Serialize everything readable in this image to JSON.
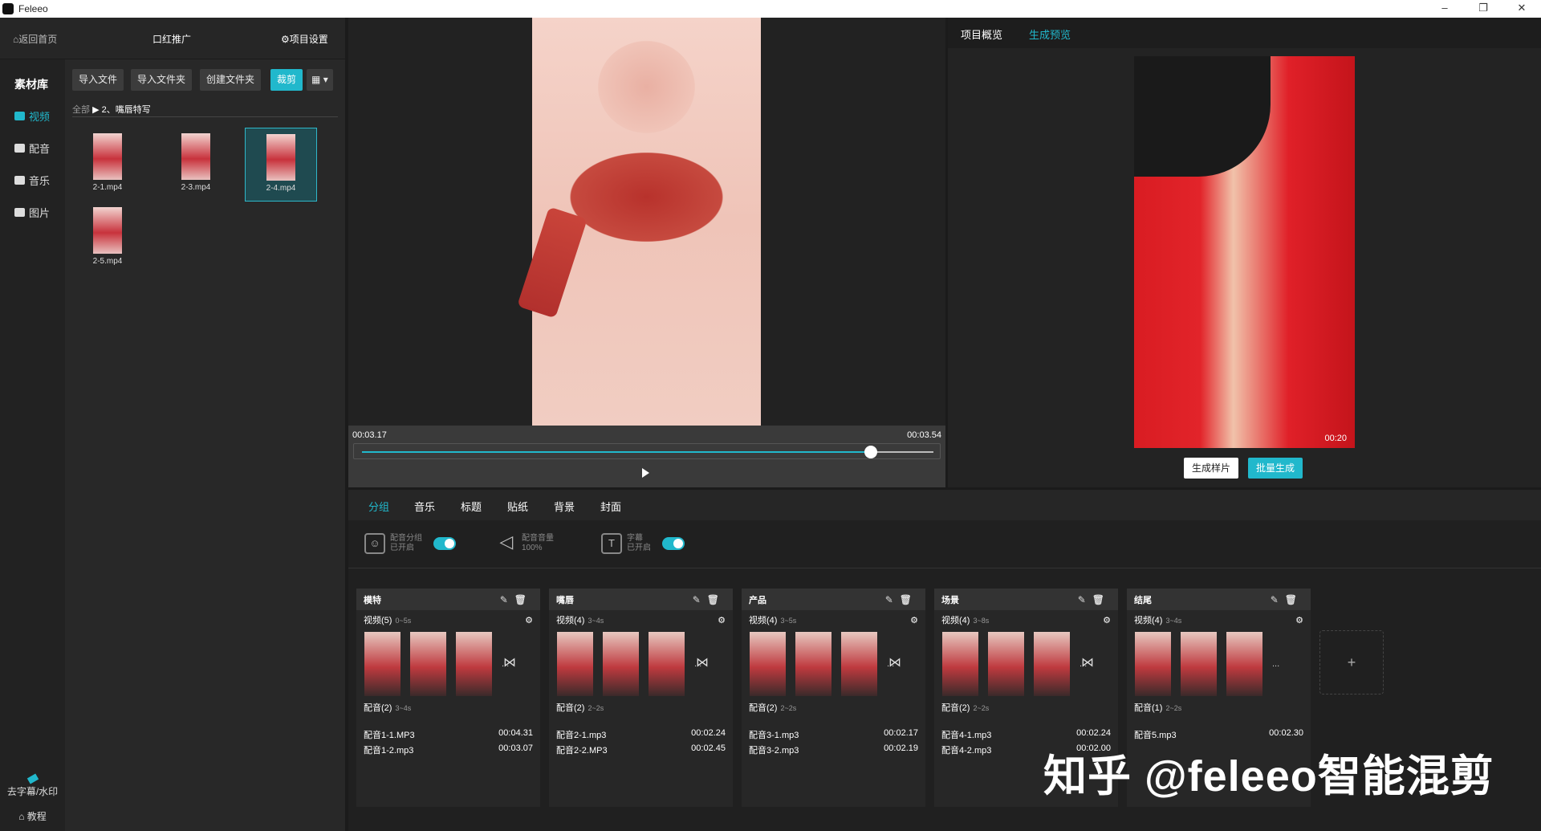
{
  "app": {
    "title": "Feleeo",
    "window_controls": [
      "–",
      "❐",
      "✕"
    ]
  },
  "header": {
    "back_label": "返回首页",
    "project_name": "口红推广",
    "settings_label": "项目设置"
  },
  "rail": {
    "heading": "素材库",
    "items": [
      {
        "label": "视频",
        "icon": "video-icon",
        "active": true
      },
      {
        "label": "配音",
        "icon": "voice-icon",
        "active": false
      },
      {
        "label": "音乐",
        "icon": "music-icon",
        "active": false
      },
      {
        "label": "图片",
        "icon": "image-icon",
        "active": false
      }
    ],
    "watermark_label": "去字幕/水印",
    "tutorial_label": "教程"
  },
  "library": {
    "buttons": [
      "导入文件",
      "导入文件夹",
      "创建文件夹",
      "裁剪"
    ],
    "active_button": "裁剪",
    "breadcrumb_root": "全部",
    "breadcrumb_path": "▶ 2、嘴唇特写",
    "assets": [
      "2-1.mp4",
      "2-3.mp4",
      "2-4.mp4",
      "2-5.mp4"
    ],
    "selected_asset": "2-4.mp4"
  },
  "preview": {
    "current_time": "00:03.17",
    "total_time": "00:03.54",
    "progress": 0.89
  },
  "generator": {
    "tabs": [
      "项目概览",
      "生成预览"
    ],
    "active_tab": "生成预览",
    "duration": "00:20",
    "sample_button": "生成样片",
    "batch_button": "批量生成",
    "accent": "#21b8cc"
  },
  "bottom": {
    "tabs": [
      "分组",
      "音乐",
      "标题",
      "贴纸",
      "背景",
      "封面"
    ],
    "active_tab": "分组",
    "options": [
      {
        "icon": "voice-group-icon",
        "title": "配音分组",
        "value": "已开启",
        "toggle": true
      },
      {
        "icon": "volume-icon",
        "title": "配音音量",
        "value": "100%",
        "toggle": false
      },
      {
        "icon": "subtitle-icon",
        "title": "字幕",
        "value": "已开启",
        "toggle": true
      }
    ],
    "groups": [
      {
        "name": "模特",
        "video_label": "视频(5)",
        "video_range": "0~5s",
        "voice_label": "配音(2)",
        "voice_range": "3~4s",
        "files": [
          {
            "name": "配音1-1.MP3",
            "dur": "00:04.31"
          },
          {
            "name": "配音1-2.mp3",
            "dur": "00:03.07"
          }
        ]
      },
      {
        "name": "嘴唇",
        "video_label": "视频(4)",
        "video_range": "3~4s",
        "voice_label": "配音(2)",
        "voice_range": "2~2s",
        "files": [
          {
            "name": "配音2-1.mp3",
            "dur": "00:02.24"
          },
          {
            "name": "配音2-2.MP3",
            "dur": "00:02.45"
          }
        ]
      },
      {
        "name": "产品",
        "video_label": "视频(4)",
        "video_range": "3~5s",
        "voice_label": "配音(2)",
        "voice_range": "2~2s",
        "files": [
          {
            "name": "配音3-1.mp3",
            "dur": "00:02.17"
          },
          {
            "name": "配音3-2.mp3",
            "dur": "00:02.19"
          }
        ]
      },
      {
        "name": "场景",
        "video_label": "视频(4)",
        "video_range": "3~8s",
        "voice_label": "配音(2)",
        "voice_range": "2~2s",
        "files": [
          {
            "name": "配音4-1.mp3",
            "dur": "00:02.24"
          },
          {
            "name": "配音4-2.mp3",
            "dur": "00:02.00"
          }
        ]
      },
      {
        "name": "结尾",
        "video_label": "视频(4)",
        "video_range": "3~4s",
        "voice_label": "配音(1)",
        "voice_range": "2~2s",
        "files": [
          {
            "name": "配音5.mp3",
            "dur": "00:02.30"
          }
        ]
      }
    ],
    "add_label": "+",
    "transition_icon": "⋈",
    "more_label": "..."
  },
  "watermark": "知乎 @feleeo智能混剪"
}
